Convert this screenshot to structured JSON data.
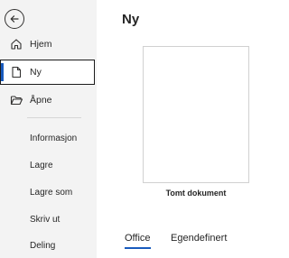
{
  "sidebar": {
    "back_label": "Tilbake",
    "nav": [
      {
        "label": "Hjem",
        "icon": "home-icon"
      },
      {
        "label": "Ny",
        "icon": "new-document-icon",
        "selected": true
      },
      {
        "label": "Åpne",
        "icon": "open-folder-icon"
      }
    ],
    "items": [
      {
        "label": "Informasjon"
      },
      {
        "label": "Lagre"
      },
      {
        "label": "Lagre som"
      },
      {
        "label": "Skriv ut"
      },
      {
        "label": "Deling"
      }
    ]
  },
  "main": {
    "title": "Ny",
    "template": {
      "label": "Tomt dokument"
    },
    "tabs": [
      {
        "label": "Office",
        "active": true
      },
      {
        "label": "Egendefinert",
        "active": false
      }
    ]
  },
  "colors": {
    "accent": "#185abd",
    "sidebar_bg": "#f3f3f3",
    "text": "#262626"
  }
}
